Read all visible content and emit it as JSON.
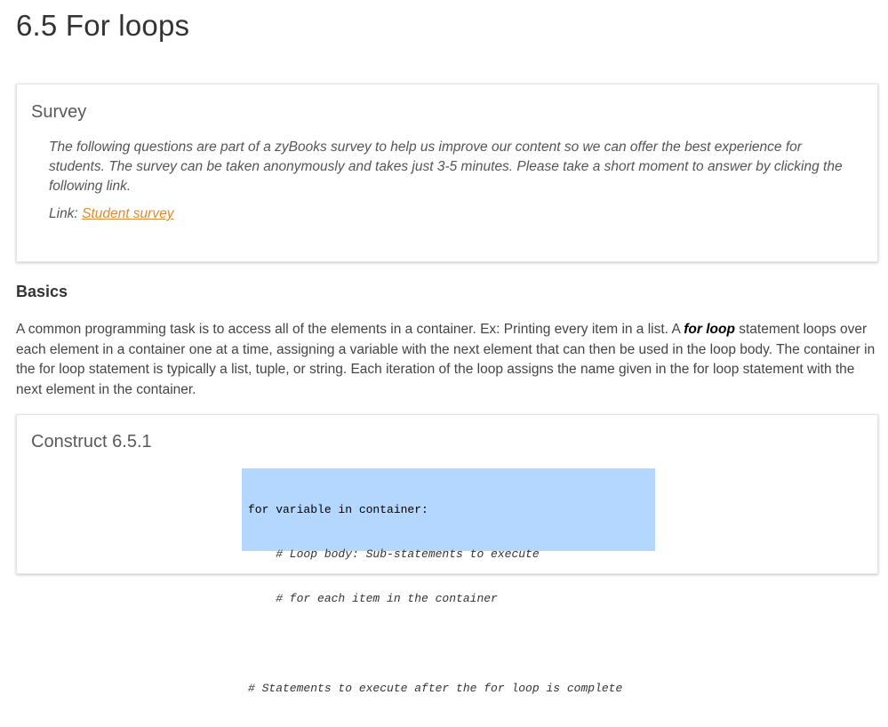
{
  "page": {
    "title": "6.5 For loops"
  },
  "survey": {
    "title": "Survey",
    "body": "The following questions are part of a zyBooks survey to help us improve our content so we can offer the best experience for students. The survey can be taken anonymously and takes just 3-5 minutes. Please take a short moment to answer by clicking the following link.",
    "link_prefix": "Link: ",
    "link_text": "Student survey",
    "link_color": "#e08a2d"
  },
  "basics": {
    "heading": "Basics",
    "para_part1": "A common programming task is to access all of the elements in a container. Ex: Printing every item in a list. A ",
    "term": "for loop",
    "para_part2": " statement loops over each element in a container one at a time, assigning a variable with the next element that can then be used in the loop body. The container in the for loop statement is typically a list, tuple, or string. Each iteration of the loop assigns the name given in the for loop statement with the next element in the container."
  },
  "construct": {
    "title": "Construct 6.5.1",
    "code_background": "#b3d7fe",
    "code_lines": [
      "for variable in container:",
      "    # Loop body: Sub-statements to execute",
      "    # for each item in the container",
      "",
      "# Statements to execute after the for loop is complete"
    ]
  }
}
